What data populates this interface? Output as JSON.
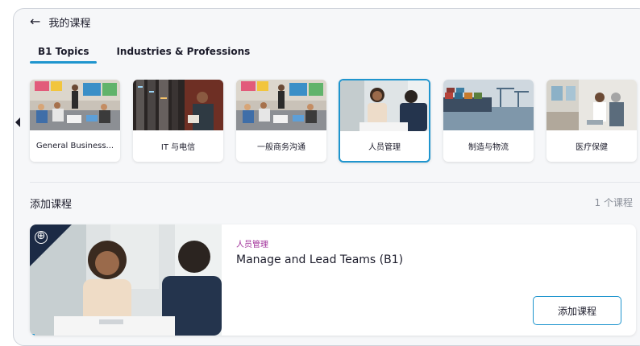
{
  "header": {
    "back_icon": "←",
    "title": "我的课程"
  },
  "tabs": [
    {
      "label": "B1 Topics",
      "active": true
    },
    {
      "label": "Industries & Professions",
      "active": false
    }
  ],
  "topics": [
    {
      "label": "General Business..."
    },
    {
      "label": "IT 与电信"
    },
    {
      "label": "一般商务沟通"
    },
    {
      "label": "人员管理",
      "selected": true
    },
    {
      "label": "制造与物流"
    },
    {
      "label": "医疗保健"
    }
  ],
  "section": {
    "title": "添加课程",
    "count": "1 个课程"
  },
  "course": {
    "tag": "人员管理",
    "title": "Manage and Lead Teams (B1)",
    "add_label": "添加课程",
    "corner_icon": "⊕"
  },
  "colors": {
    "accent": "#1f95ce",
    "tag": "#a1319a",
    "navy": "#1b2a45"
  }
}
